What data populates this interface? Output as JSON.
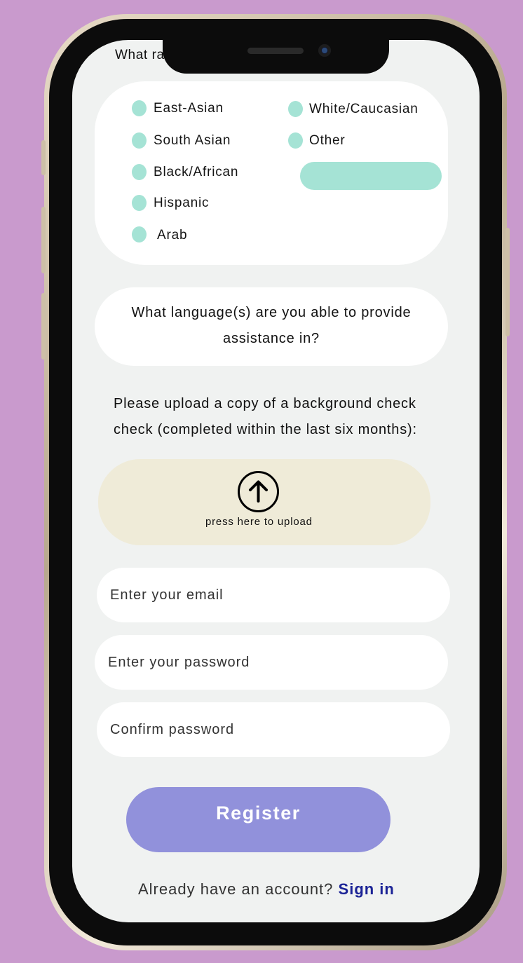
{
  "race_section": {
    "question_partial": "What ra",
    "options_left": [
      "East-Asian",
      "South Asian",
      "Black/African",
      "Hispanic",
      "Arab"
    ],
    "options_right": [
      "White/Caucasian",
      "Other"
    ],
    "other_value": ""
  },
  "language_section": {
    "question_line1": "What language(s) are you able to provide",
    "question_line2": "assistance in?"
  },
  "background_check": {
    "line1": "Please upload a copy of a background check",
    "line2": "check (completed within the last six months):",
    "upload_label": "press here to upload",
    "upload_icon": "arrow-up-circle-icon"
  },
  "form": {
    "email_placeholder": "Enter your email",
    "password_placeholder": "Enter your password",
    "confirm_placeholder": "Confirm password"
  },
  "actions": {
    "register_label": "Register",
    "signin_prompt": "Already have an account?",
    "signin_link": "Sign in"
  },
  "colors": {
    "background": "#c99acd",
    "radio": "#a5e3d5",
    "upload_box": "#efebd8",
    "register_button": "#9191db",
    "link": "#1b2396"
  }
}
